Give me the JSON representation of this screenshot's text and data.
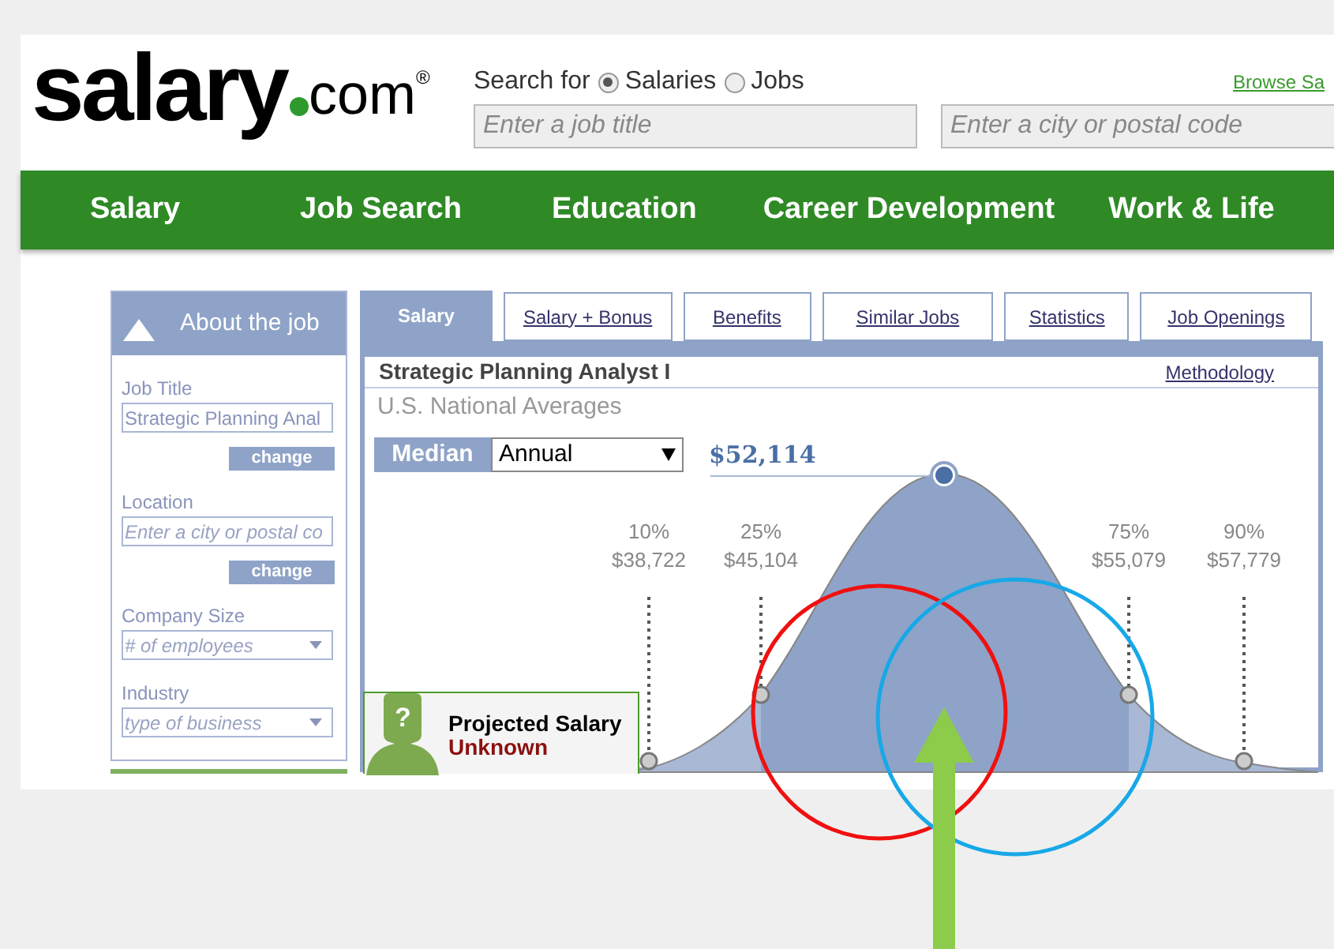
{
  "logo": {
    "wordmark": "salary",
    "suffix": "com",
    "registered": "®"
  },
  "search": {
    "label": "Search for",
    "options": [
      {
        "label": "Salaries",
        "selected": true
      },
      {
        "label": "Jobs",
        "selected": false
      }
    ],
    "job_field": {
      "placeholder": "Enter a job title"
    },
    "location_field": {
      "placeholder": "Enter a city or postal code"
    },
    "browse_link": "Browse Sa"
  },
  "nav": [
    "Salary",
    "Job Search",
    "Education",
    "Career Development",
    "Work & Life"
  ],
  "sidebar": {
    "title": "About the job",
    "fields": [
      {
        "kind": "text",
        "label": "Job Title",
        "value": "Strategic Planning Anal",
        "button": "change"
      },
      {
        "kind": "text",
        "label": "Location",
        "placeholder": "Enter a city or postal co",
        "button": "change"
      },
      {
        "kind": "select",
        "label": "Company Size",
        "placeholder": "# of employees"
      },
      {
        "kind": "select",
        "label": "Industry",
        "placeholder": "type of business"
      }
    ]
  },
  "tabs": [
    {
      "label": "Salary",
      "selected": true
    },
    {
      "label": "Salary + Bonus",
      "selected": false
    },
    {
      "label": "Benefits",
      "selected": false
    },
    {
      "label": "Similar Jobs",
      "selected": false
    },
    {
      "label": "Statistics",
      "selected": false
    },
    {
      "label": "Job Openings",
      "selected": false
    }
  ],
  "report": {
    "title": "Strategic Planning Analyst I",
    "methodology": "Methodology",
    "subtitle": "U.S. National Averages",
    "median_label": "Median",
    "period": "Annual",
    "median_value": "$52,114",
    "percentiles": [
      {
        "label": "10%",
        "value": "$38,722"
      },
      {
        "label": "25%",
        "value": "$45,104"
      },
      {
        "label": "75%",
        "value": "$55,079"
      },
      {
        "label": "90%",
        "value": "$57,779"
      }
    ],
    "projected": {
      "symbol": "?",
      "label": "Projected Salary",
      "value": "Unknown"
    }
  }
}
